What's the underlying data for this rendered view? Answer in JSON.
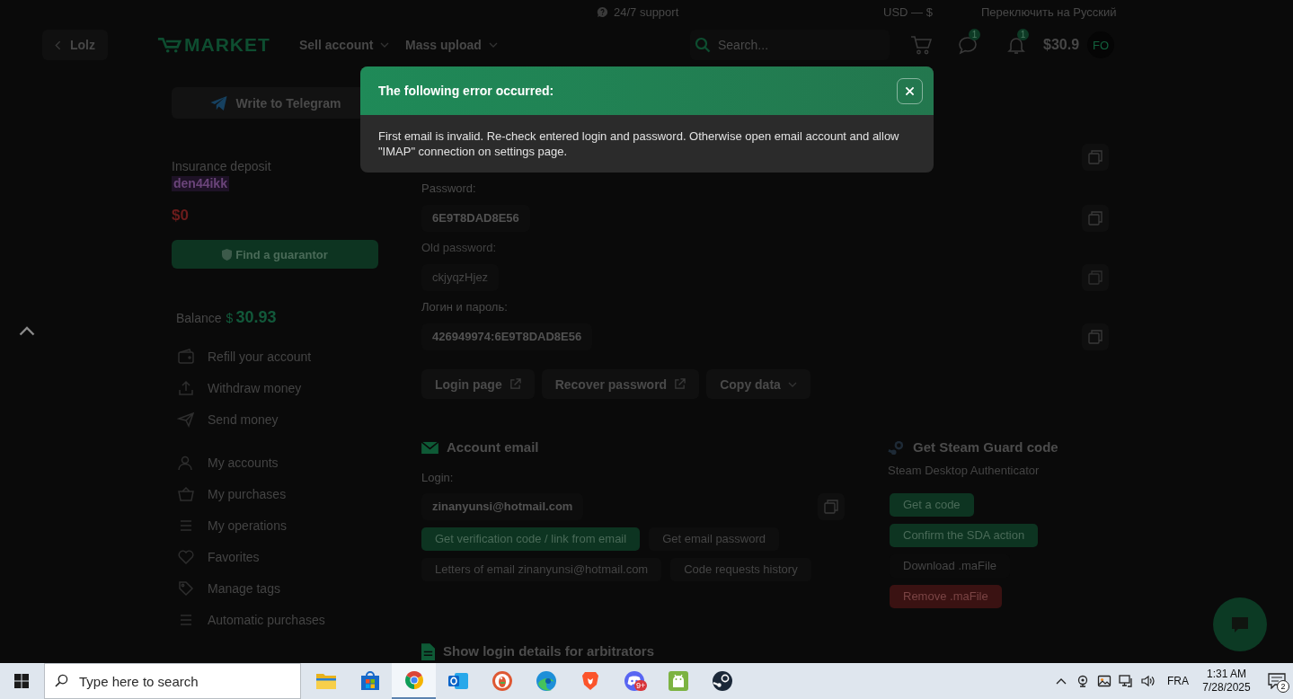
{
  "top_bar": {
    "support": "24/7 support",
    "currency": "USD — $",
    "language": "Переключить на Русский"
  },
  "header": {
    "back": "Lolz",
    "logo": "MARKET",
    "nav": [
      {
        "label": "Sell account"
      },
      {
        "label": "Mass upload"
      }
    ],
    "search": {
      "placeholder": "Search..."
    },
    "messages_badge": "1",
    "notifications_badge": "1",
    "balance": "$30.9",
    "avatar": "FO"
  },
  "sidebar": {
    "telegram_button": "Write to Telegram",
    "insurance": {
      "label": "Insurance deposit",
      "user": "den44ikk",
      "amount": "$0"
    },
    "guarantor_button": "Find a guarantor",
    "balance": {
      "label": "Balance",
      "currency": "$",
      "amount": "30.93"
    },
    "menu": [
      {
        "items": [
          {
            "label": "Refill your account"
          },
          {
            "label": "Withdraw money"
          },
          {
            "label": "Send money"
          }
        ]
      },
      {
        "items": [
          {
            "label": "My accounts"
          },
          {
            "label": "My purchases"
          },
          {
            "label": "My operations"
          },
          {
            "label": "Favorites"
          },
          {
            "label": "Manage tags"
          },
          {
            "label": "Automatic purchases"
          }
        ]
      }
    ]
  },
  "fields": [
    {
      "label": "Password:",
      "value": "6E9T8DAD8E56",
      "disabled": false
    },
    {
      "label": "Old password:",
      "value": "ckjyqzHjez",
      "disabled": true
    },
    {
      "label": "Логин и пароль:",
      "value": "426949974:6E9T8DAD8E56",
      "disabled": false
    }
  ],
  "actions": [
    {
      "label": "Login page",
      "kind": "link"
    },
    {
      "label": "Recover password",
      "kind": "link"
    },
    {
      "label": "Copy data",
      "kind": "dropdown"
    }
  ],
  "account_email": {
    "title": "Account email",
    "login_label": "Login:",
    "login": "zinanyunsi@hotmail.com",
    "button_rows": [
      [
        {
          "label": "Get verification code / link from email",
          "kind": "primary"
        },
        {
          "label": "Get email password",
          "kind": "secondary"
        }
      ],
      [
        {
          "label": "Letters of email zinanyunsi@hotmail.com",
          "kind": "secondary"
        },
        {
          "label": "Code requests history",
          "kind": "secondary"
        }
      ]
    ]
  },
  "steam_guard": {
    "title": "Get Steam Guard code",
    "subtitle": "Steam Desktop Authenticator",
    "buttons": [
      {
        "label": "Get a code",
        "kind": "primary"
      },
      {
        "label": "Confirm the SDA action",
        "kind": "primary"
      },
      {
        "label": "Download .maFile",
        "kind": "plain"
      },
      {
        "label": "Remove .maFile",
        "kind": "danger"
      }
    ]
  },
  "arbitrators": {
    "title": "Show login details for arbitrators"
  },
  "modal": {
    "title": "The following error occurred:",
    "message": "First email is invalid. Re-check entered login and password. Otherwise open email account and allow \"IMAP\" connection on settings page."
  },
  "taskbar": {
    "search_placeholder": "Type here to search",
    "apps": [
      {
        "kind": "folder",
        "selected": false
      },
      {
        "kind": "bag",
        "selected": false
      },
      {
        "kind": "ring",
        "selected": true
      },
      {
        "kind": "mail",
        "selected": false
      },
      {
        "kind": "duck",
        "selected": false
      },
      {
        "kind": "wave",
        "selected": false
      },
      {
        "kind": "shield",
        "selected": false
      },
      {
        "kind": "controller",
        "selected": false,
        "badge": "9+"
      },
      {
        "kind": "robot",
        "selected": false
      },
      {
        "kind": "disc",
        "selected": false
      }
    ],
    "language": "FRA",
    "time": "1:31 AM",
    "date": "7/28/2025",
    "notifications": "2"
  }
}
